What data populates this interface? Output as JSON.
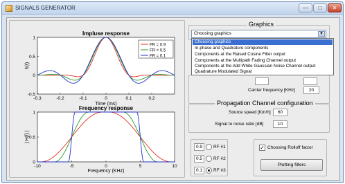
{
  "window": {
    "title": "SIGNALS GENERATOR",
    "controls": {
      "minimize": "—",
      "maximize": "□",
      "close": "✕"
    },
    "icon": "app-icon"
  },
  "impulse": {
    "title": "Impluse response",
    "xlabel": "Time (ms)",
    "ylabel": "h(t)"
  },
  "frequency": {
    "title": "Frequency response",
    "xlabel": "Frequency (KHz)",
    "ylabel": "| H(f) |"
  },
  "graphics": {
    "panel_title": "Graphics",
    "selected": "Choosing graphics",
    "options": [
      "Choosing graphics",
      "In-phase and Quadrature components",
      "Components at the Raised Cosine Filter output",
      "Components at the Multipath Fading Channel output",
      "Components at the Add White Gaussian Noise Channel output",
      "Quadrature Modulated Signal"
    ]
  },
  "modulation": {
    "carrier_label": "Carrier frequency [KHz]",
    "carrier_value": "20"
  },
  "propagation": {
    "panel_title": "Propagation Channel configuration",
    "speed_label": "Source speed [Km/h]",
    "speed_value": "60",
    "snr_label": "Signal to noise ratio [dB]",
    "snr_value": "10"
  },
  "rolloff": {
    "rows": [
      {
        "value": "0.9",
        "label": "RF  #1",
        "checked": false
      },
      {
        "value": "0.5",
        "label": "RF  #2",
        "checked": false
      },
      {
        "value": "0.1",
        "label": "RF  #3",
        "checked": true
      }
    ],
    "checkbox_label": "Choosing Rolloff factor",
    "checkbox_checked": true,
    "plot_button": "Plotting filters"
  },
  "chart_data": [
    {
      "type": "line",
      "title": "Impluse response",
      "xlabel": "Time (ms)",
      "ylabel": "h(t)",
      "xlim": [
        -0.3,
        0.3
      ],
      "ylim": [
        -0.5,
        1
      ],
      "xticks": [
        "-0.3",
        "-0.2",
        "-0.1",
        "0",
        "0.1",
        "0.2"
      ],
      "yticks": [
        "-0.5",
        "0",
        "0.5",
        "1"
      ],
      "grid": false,
      "legend": "top-right",
      "series": [
        {
          "name": "FR = 0.9",
          "color": "#e03020",
          "symbol_duration_ms": 0.1,
          "rolloff": 0.9
        },
        {
          "name": "FR = 0.5",
          "color": "#2a9a2a",
          "symbol_duration_ms": 0.1,
          "rolloff": 0.5
        },
        {
          "name": "FR = 0.1",
          "color": "#2030c8",
          "symbol_duration_ms": 0.1,
          "rolloff": 0.1
        }
      ]
    },
    {
      "type": "line",
      "title": "Frequency response",
      "xlabel": "Frequency (KHz)",
      "ylabel": "| H(f) |",
      "xlim": [
        -10,
        10
      ],
      "ylim": [
        0,
        1
      ],
      "xticks": [
        "-10",
        "-5",
        "0",
        "5",
        "10"
      ],
      "yticks": [
        "0",
        "0.5",
        "1"
      ],
      "grid": false,
      "series": [
        {
          "name": "FR = 0.9",
          "color": "#e03020",
          "bandwidth_khz": 5,
          "rolloff": 0.9
        },
        {
          "name": "FR = 0.5",
          "color": "#2a9a2a",
          "bandwidth_khz": 5,
          "rolloff": 0.5
        },
        {
          "name": "FR = 0.1",
          "color": "#2030c8",
          "bandwidth_khz": 5,
          "rolloff": 0.1
        }
      ]
    }
  ]
}
